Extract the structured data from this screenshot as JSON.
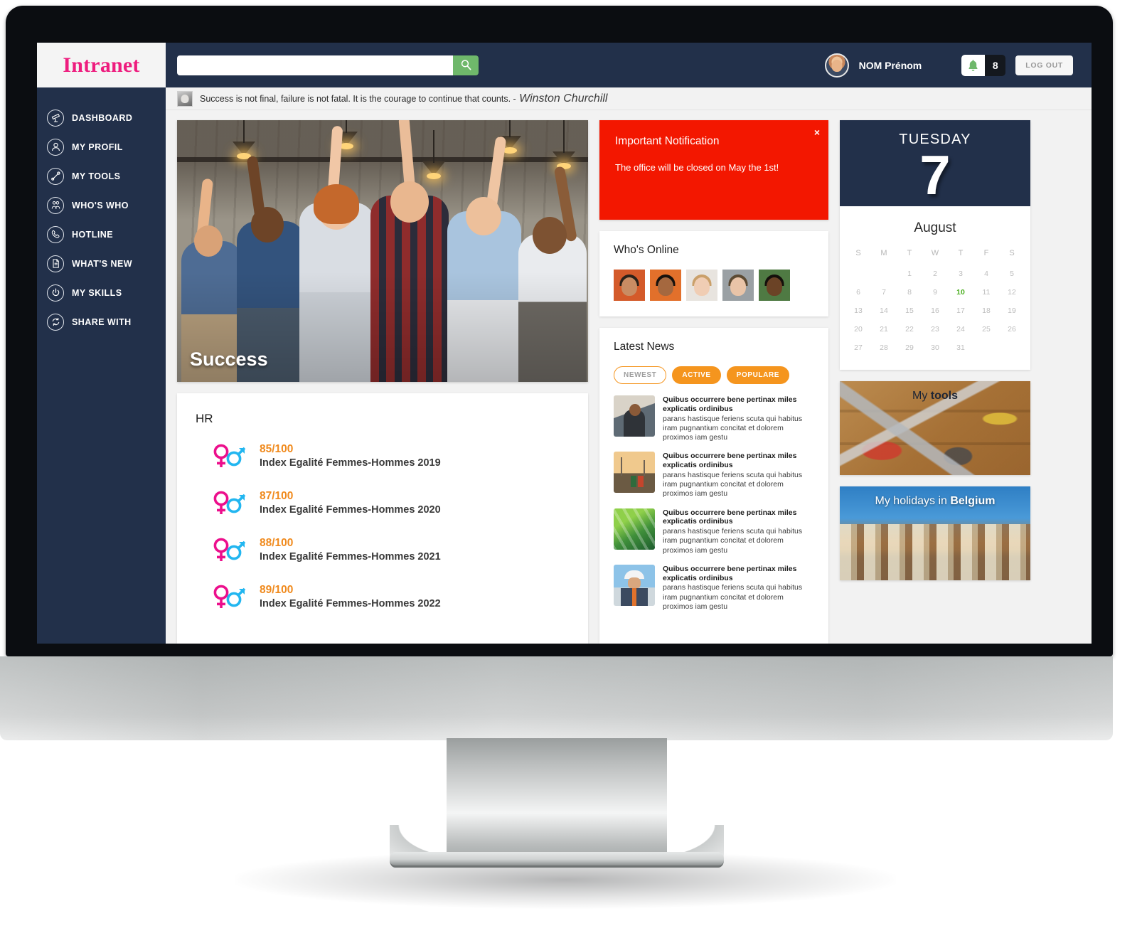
{
  "brand": {
    "name": "Intranet"
  },
  "search": {
    "value": "",
    "placeholder": "",
    "icon": "search-icon"
  },
  "user": {
    "name": "NOM Prénom",
    "notification_count": "8",
    "notification_icon": "bell-icon",
    "logout_label": "LOG OUT"
  },
  "sidebar": {
    "items": [
      {
        "label": "DASHBOARD",
        "icon": "telescope-icon"
      },
      {
        "label": "MY PROFIL",
        "icon": "person-icon"
      },
      {
        "label": "MY TOOLS",
        "icon": "wrench-icon"
      },
      {
        "label": "WHO'S WHO",
        "icon": "people-icon"
      },
      {
        "label": "HOTLINE",
        "icon": "phone-icon"
      },
      {
        "label": "WHAT'S NEW",
        "icon": "document-icon"
      },
      {
        "label": "MY SKILLS",
        "icon": "power-icon"
      },
      {
        "label": "SHARE WITH",
        "icon": "share-icon"
      }
    ]
  },
  "quote": {
    "text": "Success is not final, failure is not fatal. It is the courage to continue that counts. -",
    "author": "Winston Churchill"
  },
  "hero": {
    "caption": "Success"
  },
  "hr": {
    "title": "HR",
    "rows": [
      {
        "score": "85/100",
        "label": "Index Egalité Femmes-Hommes 2019"
      },
      {
        "score": "87/100",
        "label": "Index Egalité Femmes-Hommes 2020"
      },
      {
        "score": "88/100",
        "label": "Index Egalité Femmes-Hommes 2021"
      },
      {
        "score": "89/100",
        "label": "Index Egalité Femmes-Hommes 2022"
      }
    ]
  },
  "notification": {
    "title": "Important Notification",
    "body": "The office will be closed on May the 1st!",
    "close_label": "×",
    "color": "#f31700"
  },
  "whos_online": {
    "title": "Who's Online",
    "avatars": [
      {
        "name": "avatar-1",
        "skin": "#c98c63",
        "hair": "#2b2119",
        "bg": "#d45a2a"
      },
      {
        "name": "avatar-2",
        "skin": "#a5683f",
        "hair": "#17110c",
        "bg": "#e2702b"
      },
      {
        "name": "avatar-3",
        "skin": "#f0cdb4",
        "hair": "#caa06a",
        "bg": "#e8e4df"
      },
      {
        "name": "avatar-4",
        "skin": "#e9c4a8",
        "hair": "#5c4a33",
        "bg": "#9aa0a4"
      },
      {
        "name": "avatar-5",
        "skin": "#6b4326",
        "hair": "#14100b",
        "bg": "#4f7a43"
      }
    ]
  },
  "news": {
    "title": "Latest News",
    "tabs": [
      {
        "label": "NEWEST",
        "style": "outline"
      },
      {
        "label": "ACTIVE",
        "style": "filled"
      },
      {
        "label": "POPULARE",
        "style": "filled"
      }
    ],
    "items": [
      {
        "headline": "Quibus occurrere bene pertinax miles explicatis ordinibus",
        "body": "parans hastisque feriens scuta qui habitus iram pugnantium concitat et dolorem proximos iam gestu",
        "thumb": "thumb-office-person"
      },
      {
        "headline": "Quibus occurrere bene pertinax miles explicatis ordinibus",
        "body": "parans hastisque feriens scuta qui habitus iram pugnantium concitat et dolorem proximos iam gestu",
        "thumb": "thumb-wind-turbines"
      },
      {
        "headline": "Quibus occurrere bene pertinax miles explicatis ordinibus",
        "body": "parans hastisque feriens scuta qui habitus iram pugnantium concitat et dolorem proximos iam gestu",
        "thumb": "thumb-solar-panels"
      },
      {
        "headline": "Quibus occurrere bene pertinax miles explicatis ordinibus",
        "body": "parans hastisque feriens scuta qui habitus iram pugnantium concitat et dolorem proximos iam gestu",
        "thumb": "thumb-worker-helmet"
      }
    ]
  },
  "calendar": {
    "weekday": "TUESDAY",
    "day": "7",
    "month": "August",
    "dow": [
      "S",
      "M",
      "T",
      "W",
      "T",
      "F",
      "S"
    ],
    "leading_blanks": 2,
    "days": [
      1,
      2,
      3,
      4,
      5,
      6,
      7,
      8,
      9,
      10,
      11,
      12,
      13,
      14,
      15,
      16,
      17,
      18,
      19,
      20,
      21,
      22,
      23,
      24,
      25,
      26,
      27,
      28,
      29,
      30,
      31
    ],
    "highlighted_day": 10,
    "highlight_color": "#4caf21"
  },
  "promos": [
    {
      "prefix": "My ",
      "strong": "tools",
      "name": "promo-my-tools"
    },
    {
      "prefix": "My holidays in ",
      "strong": "Belgium",
      "name": "promo-my-holidays"
    }
  ]
}
